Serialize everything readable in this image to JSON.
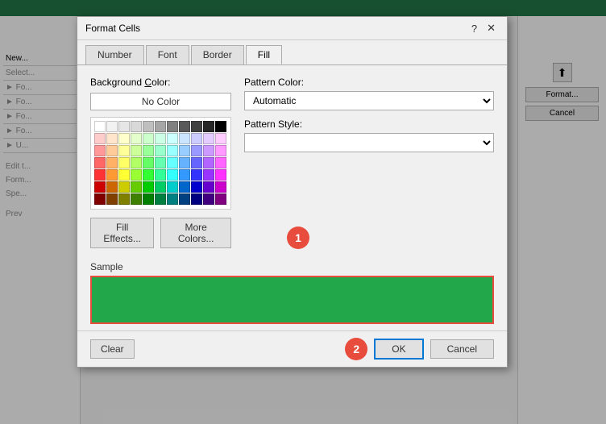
{
  "dialog": {
    "title": "Format Cells",
    "help_char": "?",
    "close_char": "✕"
  },
  "tabs": {
    "items": [
      {
        "label": "Number",
        "active": false
      },
      {
        "label": "Font",
        "active": false
      },
      {
        "label": "Border",
        "active": false
      },
      {
        "label": "Fill",
        "active": true
      }
    ]
  },
  "background_color": {
    "label": "Background Color:",
    "no_color_btn": "No Color"
  },
  "pattern_color": {
    "label": "Pattern Color:",
    "dropdown_value": "Automatic"
  },
  "pattern_style": {
    "label": "Pattern Style:"
  },
  "fill_effects_btn": "Fill Effects...",
  "more_colors_btn": "More Colors...",
  "sample": {
    "label": "Sample"
  },
  "footer": {
    "clear_btn": "Clear",
    "ok_btn": "OK",
    "cancel_btn": "Cancel"
  },
  "step1": "1",
  "step2": "2",
  "palette_row1": [
    "#ffffff",
    "#000000",
    "#ff0000",
    "#ff0000",
    "#ffff00",
    "#ffff00",
    "#00ff00",
    "#00ccff",
    "#0000ff",
    "#cc00ff"
  ],
  "palette_row2": [
    "#c0c0c0",
    "#808080",
    "#ff8080",
    "#ff8040",
    "#ffff80",
    "#80ff00",
    "#00ff80",
    "#80ffff",
    "#8080ff",
    "#ff80ff"
  ],
  "palette_row3": [
    "#f0f0f0",
    "#d0d0d0",
    "#ffcccc",
    "#ffddcc",
    "#ffffcc",
    "#ddffcc",
    "#ccffdd",
    "#ccffff",
    "#ccccff",
    "#ffccff"
  ],
  "palette_row4": [
    "#e0e0e0",
    "#b0b0b0",
    "#ff9999",
    "#ffbb99",
    "#ffff99",
    "#bbff99",
    "#99ffbb",
    "#99ffff",
    "#9999ff",
    "#ff99ff"
  ],
  "palette_row5": [
    "#d0d0d0",
    "#909090",
    "#ff6666",
    "#ff9966",
    "#ffff66",
    "#99ff66",
    "#66ff99",
    "#66ffff",
    "#6666ff",
    "#ff66ff"
  ],
  "palette_row6": [
    "#c0c0c0",
    "#707070",
    "#ff4444",
    "#ff7744",
    "#ffff44",
    "#77ff44",
    "#44ff77",
    "#44ffff",
    "#4444ff",
    "#ff44ff"
  ],
  "palette_row7": [
    "#a0a0a0",
    "#505050",
    "#cc0000",
    "#cc5500",
    "#cccc00",
    "#55cc00",
    "#00cc55",
    "#00cccc",
    "#0000cc",
    "#cc00cc"
  ],
  "palette_row8": [
    "#800000",
    "#804000",
    "#808000",
    "#008000",
    "#008080",
    "#000080",
    "#400080",
    "#800080",
    "#808040",
    "#004080"
  ],
  "selected_color": "#22a84a",
  "excel_bg": {
    "header_color": "#217346"
  }
}
